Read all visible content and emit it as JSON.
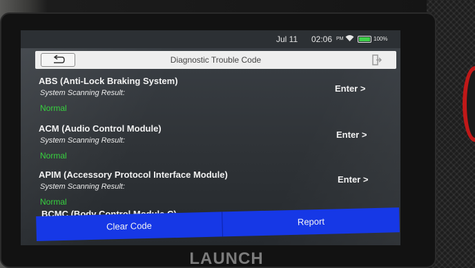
{
  "status_bar": {
    "date": "Jul 11",
    "time": "02:06",
    "ampm": "PM",
    "battery": "100%",
    "battery_level": 1.0,
    "icons": [
      "wifi-icon",
      "battery-icon"
    ]
  },
  "title_bar": {
    "title": "Diagnostic Trouble Code",
    "icons": [
      "back-arrow-icon",
      "exit-icon"
    ]
  },
  "modules": [
    {
      "name": "ABS (Anti-Lock Braking System)",
      "scan_label": "System Scanning Result:",
      "status": "Normal",
      "action": "Enter >"
    },
    {
      "name": "ACM (Audio Control Module)",
      "scan_label": "System Scanning Result:",
      "status": "Normal",
      "action": "Enter >"
    },
    {
      "name": "APIM (Accessory Protocol Interface Module)",
      "scan_label": "System Scanning Result:",
      "status": "Normal",
      "action": "Enter >"
    }
  ],
  "partial_module": "BCMC (Body Control Module C)",
  "actions": {
    "clear_code": "Clear Code",
    "report": "Report"
  },
  "device_brand": "LAUNCH",
  "colors": {
    "status_normal": "#37d23f",
    "action_blue": "#1638e6",
    "battery_green": "#3fcf4a"
  }
}
